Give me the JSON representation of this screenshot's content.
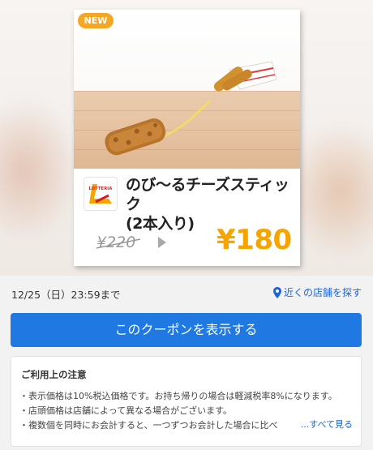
{
  "hero": {
    "badge": "NEW",
    "logo_text": "LOTTERIA",
    "title_line1": "のび～るチーズスティック",
    "title_line2": "(2本入り)",
    "price_old": "¥220",
    "price_new": "¥180"
  },
  "meta": {
    "deadline": "12/25（日）23:59まで",
    "store_link": "近くの店舗を探す"
  },
  "coupon_button": "このクーポンを表示する",
  "notes": {
    "title": "ご利用上の注意",
    "items": [
      "・表示価格は10%税込価格です。お持ち帰りの場合は軽減税率8%になります。",
      "・店頭価格は店舗によって異なる場合がございます。",
      "・複数個を同時にお会計すると、一つずつお会計した場合に比べ"
    ],
    "see_more": "...すべて見る"
  },
  "colors": {
    "accent_blue": "#2079e3",
    "price_orange": "#f5a400",
    "badge_orange": "#f5a623",
    "link_blue": "#1a66d9"
  }
}
